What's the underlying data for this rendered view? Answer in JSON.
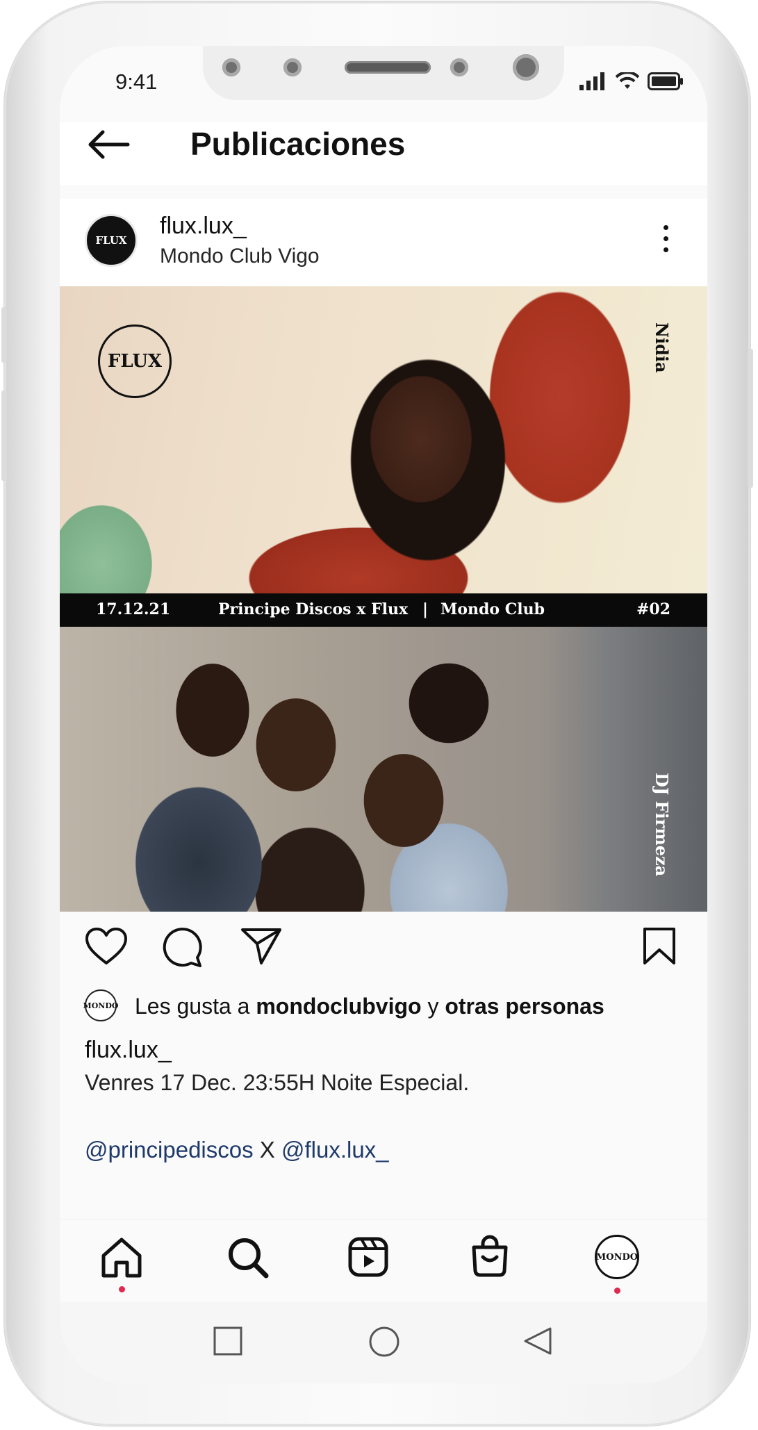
{
  "status": {
    "time": "9:41"
  },
  "header": {
    "title": "Publicaciones"
  },
  "post": {
    "username": "flux.lux_",
    "location": "Mondo Club Vigo",
    "avatar_text": "FLUX",
    "image": {
      "logo_text": "FLUX",
      "top_name": "Nidia",
      "bottom_name": "DJ Firmeza",
      "banner": {
        "date": "17.12.21",
        "title": "Principe Discos x Flux",
        "separator": "|",
        "venue": "Mondo Club",
        "number": "#02"
      }
    },
    "likes": {
      "avatar_text": "MONDO",
      "prefix": "Les gusta a ",
      "user": "mondoclubvigo",
      "connector": " y ",
      "others": "otras personas"
    },
    "caption_user": "flux.lux_",
    "caption": "Venres 17 Dec. 23:55H Noite Especial.",
    "mention1": "@principediscos",
    "mention_sep": " X ",
    "mention2": "@flux.lux_"
  },
  "tabs": {
    "profile_text": "MONDO"
  },
  "colors": {
    "notification_dot": "#e0294f",
    "mention": "#1e3a6b"
  }
}
